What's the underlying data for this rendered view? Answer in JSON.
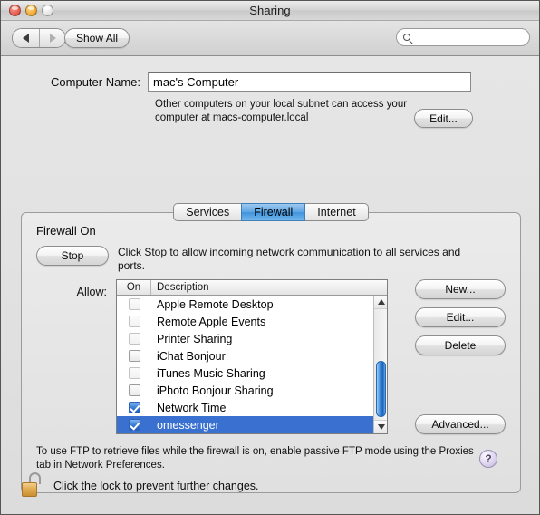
{
  "window": {
    "title": "Sharing",
    "traffic_lights": [
      "close-button",
      "minimize-button",
      "zoom-button"
    ]
  },
  "toolbar": {
    "back_icon": "triangle-left-icon",
    "forward_icon": "triangle-right-icon",
    "show_all_label": "Show All",
    "search": {
      "value": "",
      "placeholder": "",
      "icon": "search-icon"
    }
  },
  "computer_name": {
    "label": "Computer Name:",
    "value": "mac's Computer",
    "description": "Other computers on your local subnet can access your computer at macs-computer.local",
    "edit_label": "Edit..."
  },
  "tabs": [
    {
      "label": "Services",
      "active": false
    },
    {
      "label": "Firewall",
      "active": true
    },
    {
      "label": "Internet",
      "active": false
    }
  ],
  "firewall": {
    "state_label": "Firewall On",
    "stop_label": "Stop",
    "stop_note": "Click Stop to allow incoming network communication to all services and ports.",
    "allow_label": "Allow:",
    "columns": [
      "On",
      "Description"
    ],
    "rows": [
      {
        "on": false,
        "dim": true,
        "description": "Apple Remote Desktop",
        "selected": false
      },
      {
        "on": false,
        "dim": true,
        "description": "Remote Apple Events",
        "selected": false
      },
      {
        "on": false,
        "dim": true,
        "description": "Printer Sharing",
        "selected": false
      },
      {
        "on": false,
        "dim": false,
        "description": "iChat Bonjour",
        "selected": false
      },
      {
        "on": false,
        "dim": true,
        "description": "iTunes Music Sharing",
        "selected": false
      },
      {
        "on": false,
        "dim": false,
        "description": "iPhoto Bonjour Sharing",
        "selected": false
      },
      {
        "on": true,
        "dim": false,
        "description": "Network Time",
        "selected": false
      },
      {
        "on": true,
        "dim": false,
        "description": "omessenger",
        "selected": true
      }
    ],
    "buttons": {
      "new": "New...",
      "edit": "Edit...",
      "delete": "Delete",
      "advanced": "Advanced..."
    },
    "ftp_note": "To use FTP to retrieve files while the firewall is on, enable passive FTP mode using the Proxies tab in Network Preferences.",
    "help_glyph": "?"
  },
  "footer": {
    "lock_icon": "unlocked-padlock-icon",
    "lock_text": "Click the lock to prevent further changes."
  },
  "colors": {
    "selection_blue": "#3a71d1",
    "tab_active_blue": "#3e93de",
    "lock_gold": "#e0ab52"
  }
}
